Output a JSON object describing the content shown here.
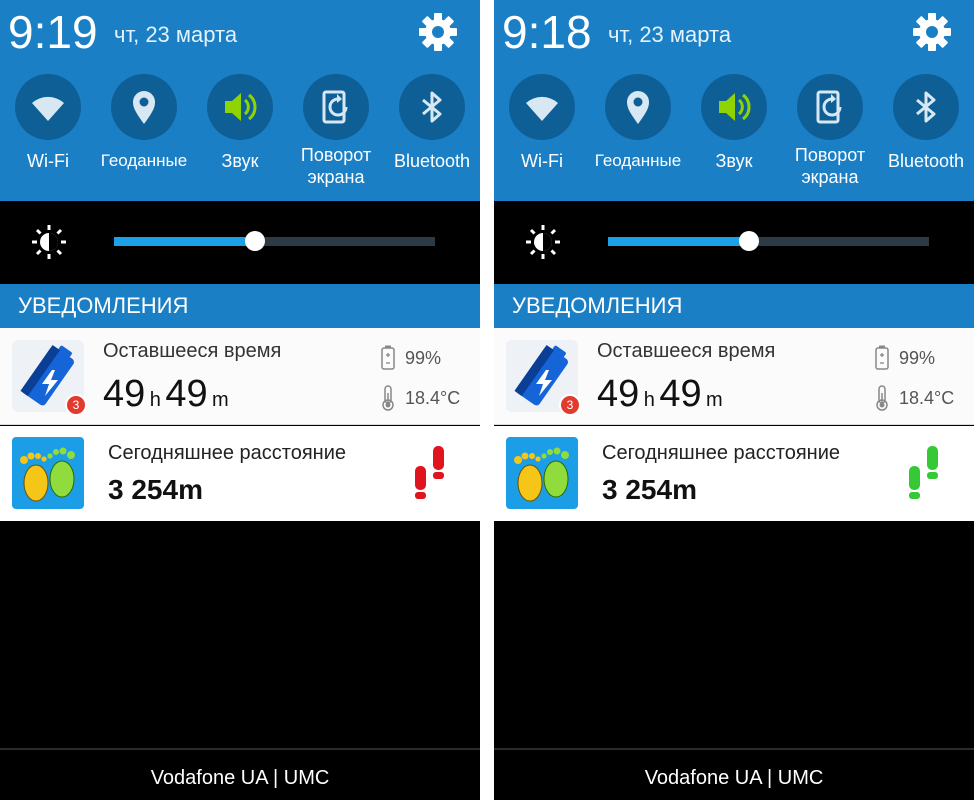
{
  "screens": [
    {
      "time": "9:19",
      "date": "чт, 23 марта",
      "toggles": [
        "Wi-Fi",
        "Геоданные",
        "Звук",
        "Поворот экрана",
        "Bluetooth"
      ],
      "toggle_icons": [
        "wifi-icon",
        "location-pin-icon",
        "speaker-icon",
        "screen-rotation-icon",
        "bluetooth-icon"
      ],
      "brightness_fraction": 0.44,
      "notifications_header": "УВЕДОМЛЕНИЯ",
      "battery_notification": {
        "title": "Оставшееся время",
        "hours": "49",
        "hours_unit": "h",
        "minutes": "49",
        "minutes_unit": "m",
        "percent": "99%",
        "temperature": "18.4°C",
        "badge": "3"
      },
      "steps_notification": {
        "title": "Сегодняшнее расстояние",
        "distance": "3 254m",
        "shoe_color": "#e0141e"
      },
      "carrier": "Vodafone UA | UMC"
    },
    {
      "time": "9:18",
      "date": "чт, 23 марта",
      "toggles": [
        "Wi-Fi",
        "Геоданные",
        "Звук",
        "Поворот экрана",
        "Bluetooth"
      ],
      "toggle_icons": [
        "wifi-icon",
        "location-pin-icon",
        "speaker-icon",
        "screen-rotation-icon",
        "bluetooth-icon"
      ],
      "brightness_fraction": 0.44,
      "notifications_header": "УВЕДОМЛЕНИЯ",
      "battery_notification": {
        "title": "Оставшееся время",
        "hours": "49",
        "hours_unit": "h",
        "minutes": "49",
        "minutes_unit": "m",
        "percent": "99%",
        "temperature": "18.4°C",
        "badge": "3"
      },
      "steps_notification": {
        "title": "Сегодняшнее расстояние",
        "distance": "3 254m",
        "shoe_color": "#37c837"
      },
      "carrier": "Vodafone UA | UMC"
    }
  ],
  "colors": {
    "header_blue": "#1a7fc4",
    "toggle_circle": "#0f5f97",
    "sound_active": "#8fd400",
    "slider_fill": "#1ba1e8"
  }
}
